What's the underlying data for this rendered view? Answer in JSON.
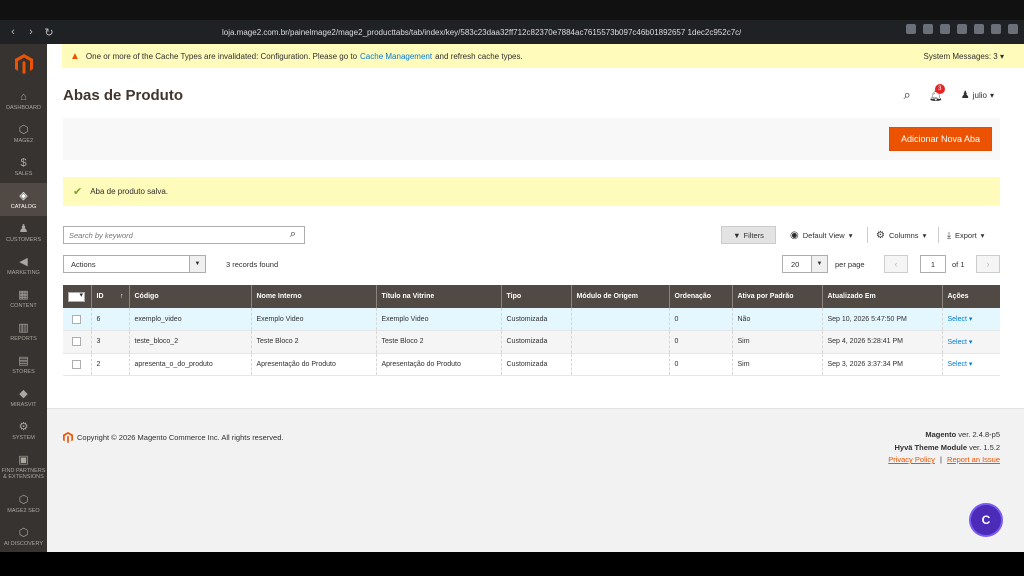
{
  "browser": {
    "url": "loja.mage2.com.br/painelmage2/mage2_producttabs/tab/index/key/583c23daa32ff712c82370e7884ac7615573b097c46b01892657 1dec2c952c7c/"
  },
  "sidebar": {
    "items": [
      {
        "label": "DASHBOARD",
        "icon": "⌂"
      },
      {
        "label": "MAGE2",
        "icon": "⬡"
      },
      {
        "label": "SALES",
        "icon": "$"
      },
      {
        "label": "CATALOG",
        "icon": "◈"
      },
      {
        "label": "CUSTOMERS",
        "icon": "♟"
      },
      {
        "label": "MARKETING",
        "icon": "◀"
      },
      {
        "label": "CONTENT",
        "icon": "▦"
      },
      {
        "label": "REPORTS",
        "icon": "▥"
      },
      {
        "label": "STORES",
        "icon": "▤"
      },
      {
        "label": "MIRASVIT",
        "icon": "◆"
      },
      {
        "label": "SYSTEM",
        "icon": "⚙"
      },
      {
        "label": "FIND PARTNERS & EXTENSIONS",
        "icon": "▣"
      },
      {
        "label": "MAGE2 SEO",
        "icon": "⬡"
      },
      {
        "label": "AI DISCOVERY",
        "icon": "⬡"
      }
    ]
  },
  "notice": {
    "text_before": "One or more of the Cache Types are invalidated: Configuration. Please go to",
    "link": "Cache Management",
    "text_after": "and refresh cache types.",
    "system_messages": "System Messages: 3"
  },
  "header": {
    "title": "Abas de Produto",
    "notification_count": "3",
    "user": "julio"
  },
  "action_bar": {
    "add_button": "Adicionar Nova Aba"
  },
  "success_message": "Aba de produto salva.",
  "toolbar": {
    "search_placeholder": "Search by keyword",
    "filters": "Filters",
    "view": "Default View",
    "columns": "Columns",
    "export": "Export",
    "actions": "Actions",
    "records": "3 records found",
    "per_page_value": "20",
    "per_page_label": "per page",
    "page": "1",
    "of_pages": "of 1"
  },
  "table": {
    "headers": [
      "ID",
      "↑",
      "Código",
      "Nome Interno",
      "Título na Vitrine",
      "Tipo",
      "Módulo de Origem",
      "Ordenação",
      "Ativa por Padrão",
      "Atualizado Em",
      "Ações"
    ],
    "rows": [
      {
        "id": "6",
        "code": "exemplo_video",
        "internal": "Exemplo Video",
        "title": "Exemplo Video",
        "type": "Customizada",
        "module": "",
        "order": "0",
        "active": "Não",
        "updated": "Sep 10, 2026 5:47:50 PM",
        "action": "Select"
      },
      {
        "id": "3",
        "code": "teste_bloco_2",
        "internal": "Teste Bloco 2",
        "title": "Teste Bloco 2",
        "type": "Customizada",
        "module": "",
        "order": "0",
        "active": "Sim",
        "updated": "Sep 4, 2026 5:28:41 PM",
        "action": "Select"
      },
      {
        "id": "2",
        "code": "apresenta_o_do_produto",
        "internal": "Apresentação do Produto",
        "title": "Apresentação do Produto",
        "type": "Customizada",
        "module": "",
        "order": "0",
        "active": "Sim",
        "updated": "Sep 3, 2026 3:37:34 PM",
        "action": "Select"
      }
    ]
  },
  "footer": {
    "copyright": "Copyright © 2026 Magento Commerce Inc. All rights reserved.",
    "magento_name": "Magento",
    "magento_ver": "ver. 2.4.8-p5",
    "hyva_name": "Hyvä Theme Module",
    "hyva_ver": "ver. 1.5.2",
    "privacy": "Privacy Policy",
    "separator": "|",
    "report": "Report an Issue"
  },
  "chat": {
    "label": "C"
  },
  "colors": {
    "accent": "#eb5202",
    "sidebar": "#373330",
    "grid_header": "#514943",
    "link": "#007bdb"
  }
}
